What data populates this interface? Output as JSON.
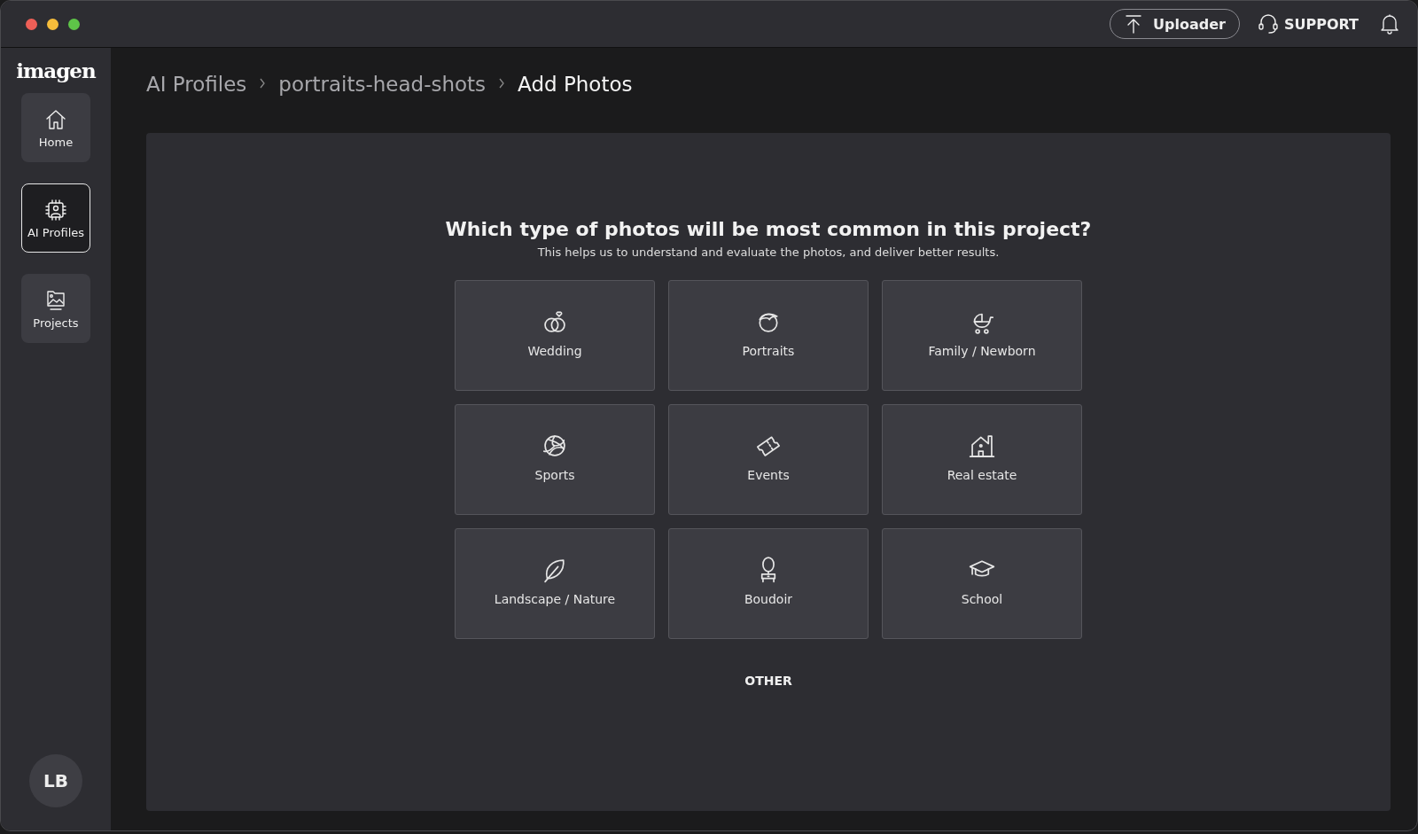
{
  "top_bar": {
    "uploader_button": "Uploader",
    "support_link": "SUPPORT"
  },
  "sidebar": {
    "logo": "imagen",
    "items": [
      {
        "label": "Home",
        "selected": false
      },
      {
        "label": "AI Profiles",
        "selected": true
      },
      {
        "label": "Projects",
        "selected": false
      }
    ],
    "avatar": "LB"
  },
  "breadcrumbs": [
    {
      "label": "AI Profiles",
      "current": false
    },
    {
      "label": "portraits-head-shots",
      "current": false
    },
    {
      "label": "Add Photos",
      "current": true
    }
  ],
  "question": {
    "title": "Which type of photos will be most common in this project?",
    "subtitle": "This helps us to understand and evaluate the photos, and deliver better results."
  },
  "photo_types": [
    {
      "label": "Wedding"
    },
    {
      "label": "Portraits"
    },
    {
      "label": "Family / Newborn"
    },
    {
      "label": "Sports"
    },
    {
      "label": "Events"
    },
    {
      "label": "Real estate"
    },
    {
      "label": "Landscape / Nature"
    },
    {
      "label": "Boudoir"
    },
    {
      "label": "School"
    }
  ],
  "other_button": "OTHER"
}
